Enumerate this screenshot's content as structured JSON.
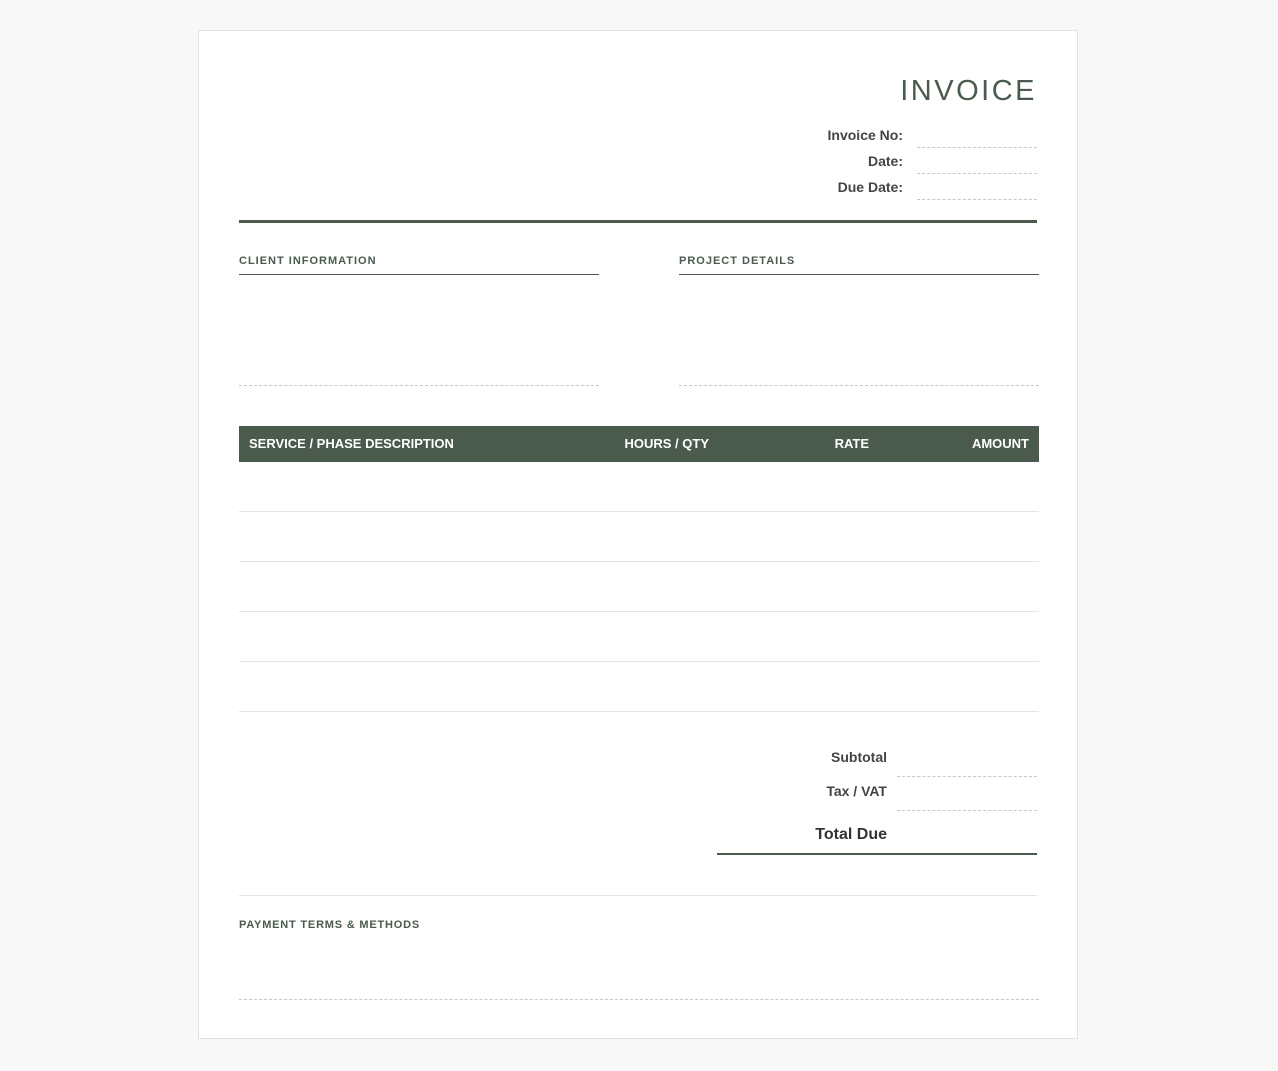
{
  "invoice": {
    "title": "INVOICE",
    "meta": [
      {
        "label": "Invoice No:",
        "value": ""
      },
      {
        "label": "Date:",
        "value": ""
      },
      {
        "label": "Due Date:",
        "value": ""
      }
    ]
  },
  "sections": {
    "client_label": "CLIENT INFORMATION",
    "client_value": "",
    "project_label": "PROJECT DETAILS",
    "project_value": ""
  },
  "table": {
    "columns": [
      "SERVICE / PHASE DESCRIPTION",
      "HOURS / QTY",
      "RATE",
      "AMOUNT"
    ],
    "rows": [
      {
        "description": "",
        "qty": "",
        "rate": "",
        "amount": ""
      },
      {
        "description": "",
        "qty": "",
        "rate": "",
        "amount": ""
      },
      {
        "description": "",
        "qty": "",
        "rate": "",
        "amount": ""
      },
      {
        "description": "",
        "qty": "",
        "rate": "",
        "amount": ""
      },
      {
        "description": "",
        "qty": "",
        "rate": "",
        "amount": ""
      }
    ]
  },
  "totals": {
    "subtotal_label": "Subtotal",
    "subtotal_value": "",
    "tax_label": "Tax / VAT",
    "tax_value": "",
    "total_label": "Total Due",
    "total_value": ""
  },
  "payment": {
    "label": "PAYMENT TERMS & METHODS",
    "value": ""
  },
  "colors": {
    "accent": "#4a5a4d",
    "background": "#f8f8f8",
    "sheet": "#ffffff"
  }
}
